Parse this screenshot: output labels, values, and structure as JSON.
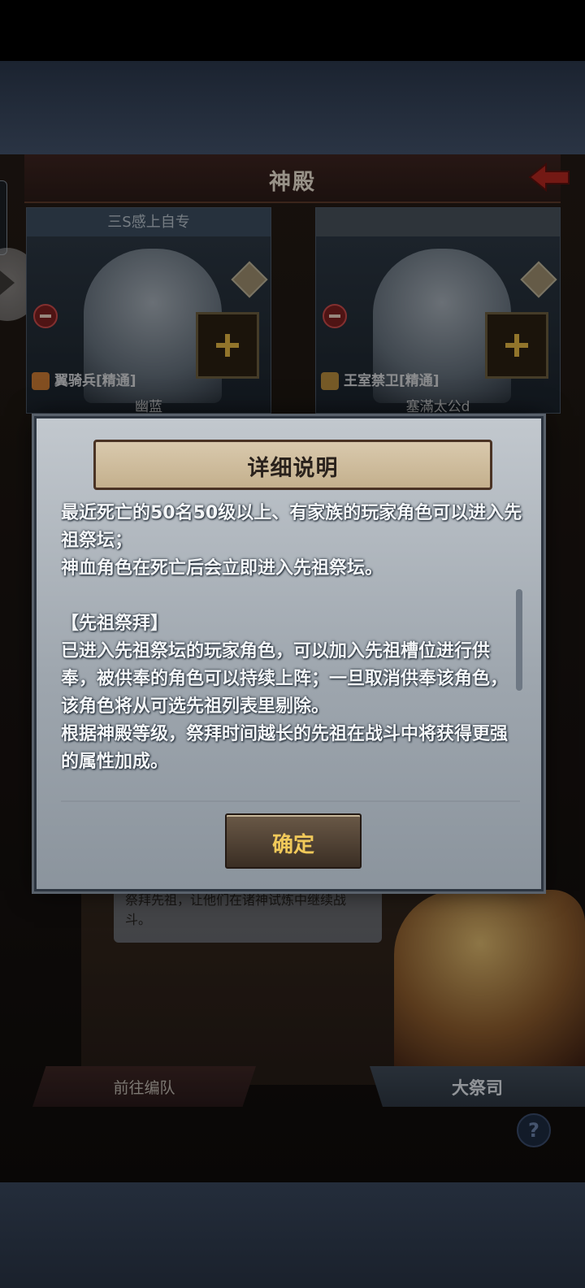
{
  "header": {
    "title": "神殿"
  },
  "slots": [
    {
      "name_plate": "三S感上自专",
      "role": "翼骑兵[精通]",
      "character": "幽蓝"
    },
    {
      "name_plate": "",
      "role": "王室禁卫[精通]",
      "character": "塞滿太公d"
    }
  ],
  "dialog": {
    "title": "详细说明",
    "paragraphs": [
      "最近死亡的50名50级以上、有家族的玩家角色可以进入先祖祭坛；",
      "神血角色在死亡后会立即进入先祖祭坛。",
      "",
      "【先祖祭拜】",
      "已进入先祖祭坛的玩家角色，可以加入先祖槽位进行供奉，被供奉的角色可以持续上阵；一旦取消供奉该角色，该角色将从可选先祖列表里剔除。",
      "根据神殿等级，祭拜时间越长的先祖在战斗中将获得更强的属性加成。"
    ],
    "confirm_label": "确定"
  },
  "npc": {
    "speech": "祭拜先祖，让他们在诸神试炼中继续战斗。",
    "name": "大祭司"
  },
  "bottom": {
    "goto_label": "前往编队",
    "help_label": "?"
  }
}
